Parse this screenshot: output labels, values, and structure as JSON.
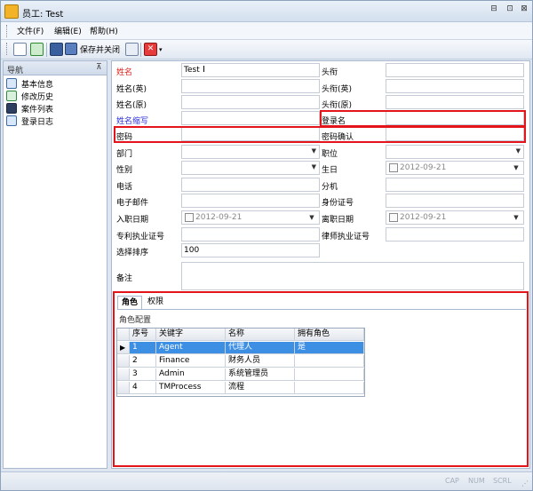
{
  "window": {
    "title": "员工: Test"
  },
  "menu": {
    "items": [
      "文件(F)",
      "编辑(E)",
      "帮助(H)"
    ]
  },
  "toolbar": {
    "save_close_label": "保存并关闭"
  },
  "nav": {
    "title": "导航",
    "pin": "ᵖ",
    "items": [
      "基本信息",
      "修改历史",
      "案件列表",
      "登录日志"
    ]
  },
  "form": {
    "name_label": "姓名",
    "name_value": "Test",
    "name_en_label": "姓名(英)",
    "name_orig_label": "姓名(原)",
    "abbr_label": "姓名缩写",
    "password_label": "密码",
    "dept_label": "部门",
    "gender_label": "性别",
    "phone_label": "电话",
    "email_label": "电子邮件",
    "hire_date_label": "入职日期",
    "hire_date_value": "2012-09-21",
    "patent_cert_label": "专利执业证号",
    "sort_label": "选择排序",
    "sort_value": "100",
    "title_label": "头衔",
    "title_en_label": "头衔(英)",
    "title_orig_label": "头衔(原)",
    "login_label": "登录名",
    "password_confirm_label": "密码确认",
    "position_label": "职位",
    "birthday_label": "生日",
    "birthday_value": "2012-09-21",
    "ext_label": "分机",
    "id_label": "身份证号",
    "leave_date_label": "离职日期",
    "leave_date_value": "2012-09-21",
    "lawyer_cert_label": "律师执业证号",
    "notes_label": "备注"
  },
  "tabs": {
    "roles": "角色",
    "permissions": "权限",
    "section_title": "角色配置"
  },
  "grid": {
    "headers": [
      "序号",
      "关键字",
      "名称",
      "拥有角色"
    ],
    "rows": [
      [
        "1",
        "Agent",
        "代理人",
        "是"
      ],
      [
        "2",
        "Finance",
        "财务人员",
        ""
      ],
      [
        "3",
        "Admin",
        "系统管理员",
        ""
      ],
      [
        "4",
        "TMProcess",
        "流程",
        ""
      ]
    ]
  },
  "status": {
    "cap": "CAP",
    "num": "NUM",
    "scrl": "SCRL"
  },
  "colors": {
    "highlight_red": "#e3151a",
    "selection_blue": "#3d8fe3",
    "required_label_red": "#e0201c",
    "link_label_blue": "#2b2fd9"
  }
}
